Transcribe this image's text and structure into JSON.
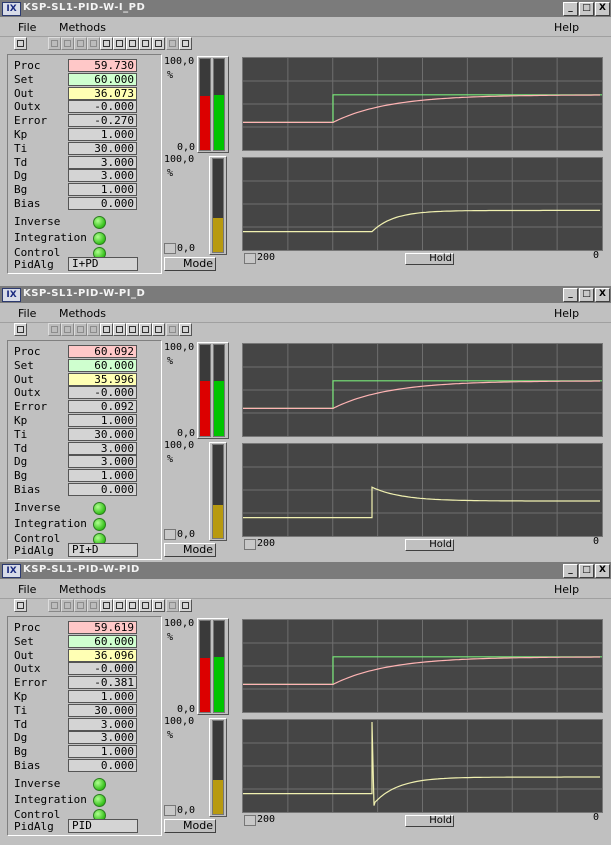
{
  "common": {
    "title_icon": "IX",
    "window_buttons": [
      "_",
      "□",
      "X"
    ],
    "menu": {
      "file": "File",
      "methods": "Methods",
      "help": "Help"
    },
    "param_labels": [
      "Proc",
      "Set",
      "Out",
      "Outx",
      "Error",
      "Kp",
      "Ti",
      "Td",
      "Dg",
      "Bg",
      "Bias"
    ],
    "flag_labels": [
      "Inverse",
      "Integration",
      "Control"
    ],
    "alg_label": "PidAlg",
    "scale_top": "100,0",
    "scale_unit": "%",
    "scale_bottom": "0,0",
    "mode_label": "Mode",
    "hold_label": "Hold",
    "time_left": "200",
    "time_right": "0",
    "colors": {
      "proc": "#ffc8c8",
      "set": "#cfffcf",
      "out": "#ffffb4",
      "bar_red": "#dc0000",
      "bar_green": "#00c400",
      "bar_yellow": "#b89a10",
      "trace_proc": "#ffb4b4",
      "trace_set": "#78e878",
      "trace_out": "#f0f0b0",
      "graph_bg": "#454545",
      "grid": "#6e6e6e"
    }
  },
  "windows": [
    {
      "title": "KSP-SL1-PID-W-I_PD",
      "values": [
        "59.730",
        "60.000",
        "36.073",
        "-0.000",
        "-0.270",
        "1.000",
        "30.000",
        "3.000",
        "3.000",
        "1.000",
        "0.000"
      ],
      "flags": [
        true,
        true,
        true
      ],
      "alg": "I+PD",
      "levels": {
        "proc": 59.7,
        "set": 60.0,
        "out": 36.1
      }
    },
    {
      "title": "KSP-SL1-PID-W-PI_D",
      "values": [
        "60.092",
        "60.000",
        "35.996",
        "-0.000",
        "0.092",
        "1.000",
        "30.000",
        "3.000",
        "3.000",
        "1.000",
        "0.000"
      ],
      "flags": [
        true,
        true,
        true
      ],
      "alg": "PI+D",
      "levels": {
        "proc": 60.1,
        "set": 60.0,
        "out": 36.0
      }
    },
    {
      "title": "KSP-SL1-PID-W-PID",
      "values": [
        "59.619",
        "60.000",
        "36.096",
        "-0.000",
        "-0.381",
        "1.000",
        "30.000",
        "3.000",
        "3.000",
        "1.000",
        "0.000"
      ],
      "flags": [
        true,
        true,
        true
      ],
      "alg": "PID",
      "levels": {
        "proc": 59.6,
        "set": 60.0,
        "out": 36.1
      }
    }
  ]
}
